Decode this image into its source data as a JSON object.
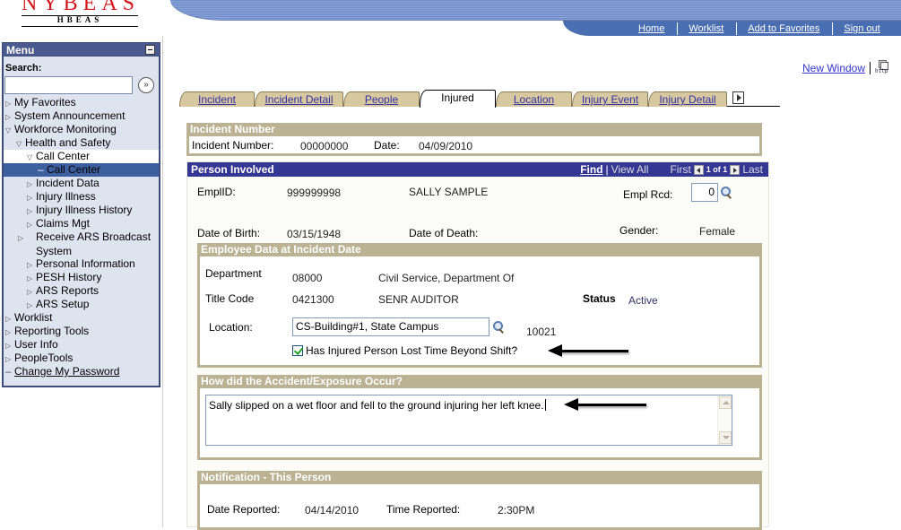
{
  "app": {
    "logo_main": "NYBEAS",
    "logo_sub": "HBEAS"
  },
  "header_nav": [
    {
      "label": "Home"
    },
    {
      "label": "Worklist"
    },
    {
      "label": "Add to Favorites"
    },
    {
      "label": "Sign out"
    }
  ],
  "new_window": {
    "label": "New Window",
    "icon": "http-icon",
    "icon_text": "http"
  },
  "menu": {
    "title": "Menu",
    "search_label": "Search:",
    "search_value": "",
    "items": [
      {
        "label": "My Favorites",
        "state": "collapsed",
        "level": 0
      },
      {
        "label": "System Announcement",
        "state": "collapsed",
        "level": 0
      },
      {
        "label": "Workforce Monitoring",
        "state": "expanded",
        "level": 0
      },
      {
        "label": "Health and Safety",
        "state": "expanded",
        "level": 1
      },
      {
        "label": "Call Center",
        "state": "expanded",
        "level": 2
      },
      {
        "label": "Call Center",
        "state": "leaf-selected",
        "level": 3
      },
      {
        "label": "Incident Data",
        "state": "collapsed",
        "level": 2
      },
      {
        "label": "Injury Illness",
        "state": "collapsed",
        "level": 2
      },
      {
        "label": "Injury Illness History",
        "state": "collapsed",
        "level": 2
      },
      {
        "label": "Claims Mgt",
        "state": "collapsed",
        "level": 2
      },
      {
        "label": "Receive ARS Broadcast System",
        "state": "collapsed",
        "level": 2
      },
      {
        "label": "Personal Information",
        "state": "collapsed",
        "level": 2
      },
      {
        "label": "PESH History",
        "state": "collapsed",
        "level": 2
      },
      {
        "label": "ARS Reports",
        "state": "collapsed",
        "level": 2
      },
      {
        "label": "ARS Setup",
        "state": "collapsed",
        "level": 2
      },
      {
        "label": "Worklist",
        "state": "collapsed",
        "level": 0
      },
      {
        "label": "Reporting Tools",
        "state": "collapsed",
        "level": 0
      },
      {
        "label": "User Info",
        "state": "collapsed",
        "level": 0
      },
      {
        "label": "PeopleTools",
        "state": "collapsed",
        "level": 0
      },
      {
        "label": "Change My Password",
        "state": "link",
        "level": 0
      }
    ]
  },
  "tabs": [
    {
      "label": "Incident",
      "active": false
    },
    {
      "label": "Incident Detail",
      "active": false
    },
    {
      "label": "People",
      "active": false
    },
    {
      "label": "Injured",
      "active": true
    },
    {
      "label": "Location",
      "active": false
    },
    {
      "label": "Injury Event",
      "active": false
    },
    {
      "label": "Injury Detail",
      "active": false
    }
  ],
  "incident_number": {
    "title": "Incident Number",
    "number_label": "Incident Number:",
    "number_value": "00000000",
    "date_label": "Date:",
    "date_value": "04/09/2010"
  },
  "person_involved": {
    "title": "Person Involved",
    "find_label": "Find",
    "view_all_label": "View All",
    "first_label": "First",
    "count_label": "1 of 1",
    "last_label": "Last",
    "emplid_label": "EmplID:",
    "emplid_value": "999999998",
    "name_value": "SALLY SAMPLE",
    "empl_rcd_label": "Empl Rcd:",
    "empl_rcd_value": "0",
    "dob_label": "Date of Birth:",
    "dob_value": "03/15/1948",
    "dod_label": "Date of Death:",
    "dod_value": "",
    "gender_label": "Gender:",
    "gender_value": "Female"
  },
  "employee_data": {
    "title": "Employee Data at Incident Date",
    "department_label": "Department",
    "department_code": "08000",
    "department_name": "Civil Service, Department Of",
    "title_code_label": "Title Code",
    "title_code": "0421300",
    "title_name": "SENR AUDITOR",
    "status_label": "Status",
    "status_value": "Active",
    "location_label": "Location:",
    "location_value": "CS-Building#1, State Campus",
    "location_code": "10021",
    "lost_time_label": "Has Injured Person Lost Time Beyond Shift?",
    "lost_time_checked": true
  },
  "accident": {
    "title": "How did the Accident/Exposure Occur?",
    "description": "Sally slipped on a wet floor and fell to the ground injuring her left knee."
  },
  "notification": {
    "title": "Notification - This Person",
    "date_label": "Date Reported:",
    "date_value": "04/14/2010",
    "time_label": "Time Reported:",
    "time_value": "2:30PM"
  }
}
